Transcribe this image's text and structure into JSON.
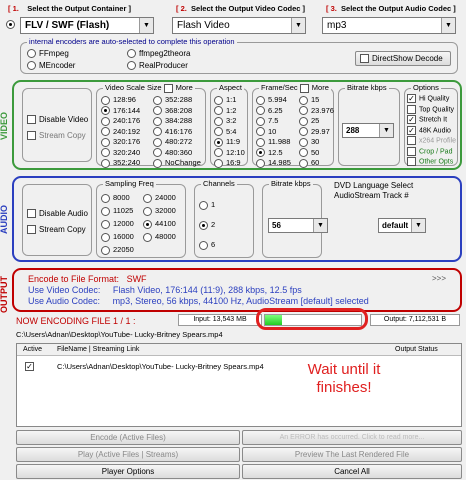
{
  "steps": {
    "s1_num": "[ 1.",
    "s1": "Select the Output Container ]",
    "s2_num": "[ 2.",
    "s2": "Select the Output Video Codec ]",
    "s3_num": "[ 3.",
    "s3": "Select the Output Audio Codec ]"
  },
  "selects": {
    "container": "FLV / SWF (Flash)",
    "video_codec": "Flash Video",
    "audio_codec": "mp3"
  },
  "encoders": {
    "title": "internal encoders are auto-selected to complete this operation",
    "options": [
      "FFmpeg",
      "ffmpeg2theora",
      "MEncoder",
      "RealProducer"
    ],
    "directshow": "DirectShow Decode"
  },
  "video": {
    "label": "VIDEO",
    "disable": "Disable Video",
    "streamcopy": "Stream Copy",
    "scale_title": "Video Scale Size",
    "scale_more": "More",
    "scale_col1": [
      "128:96",
      "176:144",
      "240:176",
      "240:192",
      "320:176",
      "320:240",
      "352:240"
    ],
    "scale_col2": [
      "352:288",
      "368:208",
      "384:288",
      "416:176",
      "480:272",
      "480:360",
      "NoChange"
    ],
    "aspect_title": "Aspect",
    "aspect": [
      "1:1",
      "1:2",
      "3:2",
      "5:4",
      "11:9",
      "12:10",
      "16:9"
    ],
    "fps_title": "Frame/Sec",
    "fps_more": "More",
    "fps_col1": [
      "5.994",
      "6.25",
      "7.5",
      "10",
      "11.988",
      "12.5",
      "14.985"
    ],
    "fps_col2": [
      "15",
      "23.976",
      "25",
      "29.97",
      "30",
      "50",
      "60"
    ],
    "bitrate_title": "Bitrate  kbps",
    "bitrate": "288",
    "options_title": "Options",
    "options": [
      "Hi Quality",
      "Top Quality",
      "Stretch It",
      "48K Audio",
      "x264 Profile",
      "Crop / Pad",
      "Other Opts"
    ]
  },
  "audio": {
    "label": "AUDIO",
    "disable": "Disable Audio",
    "streamcopy": "Stream Copy",
    "freq_title": "Sampling Freq",
    "freq_col1": [
      "8000",
      "11025",
      "12000",
      "16000",
      "22050"
    ],
    "freq_col2": [
      "24000",
      "32000",
      "44100",
      "48000"
    ],
    "channels_title": "Channels",
    "channels": [
      "1",
      "2",
      "6"
    ],
    "bitrate_title": "Bitrate  kbps",
    "bitrate": "56",
    "dvd_title": "DVD Language Select",
    "dvd_sub": "AudioStream  Track #",
    "dvd_value": "default"
  },
  "output": {
    "label": "OUTPUT",
    "format_label": "Encode to File Format:",
    "format_value": "SWF",
    "video_label": "Use Video Codec:",
    "video_value": "Flash Video,  176:144 (11:9),  288 kbps,  12.5 fps",
    "audio_label": "Use Audio Codec:",
    "audio_value": "mp3,  Stereo,  56 kbps,  44100 Hz,  AudioStream [default] selected",
    "more": ">>>"
  },
  "status": {
    "encoding": "NOW ENCODING FILE 1 / 1 :",
    "input": "Input: 13,543 MB",
    "output": "Output: 7,112,531 B",
    "progress": 0.18,
    "filepath": "C:\\Users\\Adnan\\Desktop\\YouTube- Lucky-Britney Spears.mp4"
  },
  "table": {
    "col_active": "Active",
    "col_filename": "FileName  |  Streaming Link",
    "col_status": "Output Status",
    "row_path": "C:\\Users\\Adnan\\Desktop\\YouTube- Lucky-Britney Spears.mp4"
  },
  "annotation": "Wait until it finishes!",
  "buttons": {
    "encode": "Encode (Active Files)",
    "error": "An ERROR has occurred.  Click to read more...",
    "play": "Play (Active Files | Streams)",
    "preview": "Preview The Last Rendered File",
    "player_options": "Player Options",
    "cancel_all": "Cancel All"
  },
  "colors": {
    "video": "#3c9a3c",
    "audio": "#2b3fbf",
    "output": "#c00000",
    "progress": "#22cc22",
    "highlight": "#e02020"
  }
}
